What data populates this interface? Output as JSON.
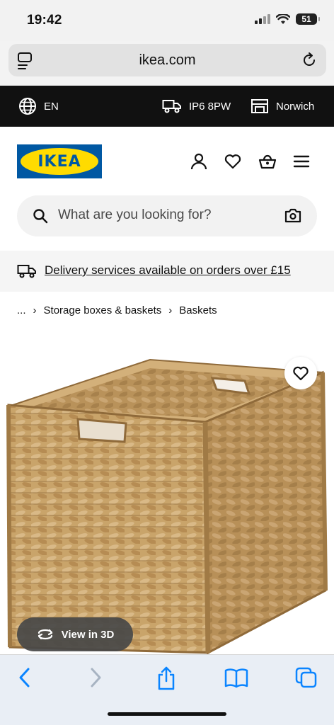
{
  "status": {
    "time": "19:42",
    "battery": "51"
  },
  "browser": {
    "url": "ikea.com"
  },
  "top_strip": {
    "language": "EN",
    "postcode": "IP6 8PW",
    "store": "Norwich"
  },
  "header": {
    "logo": "IKEA",
    "search_placeholder": "What are you looking for?"
  },
  "delivery": {
    "text": "Delivery services available on orders over £15"
  },
  "breadcrumb": {
    "ellipsis": "...",
    "items": [
      "Storage boxes & baskets",
      "Baskets"
    ]
  },
  "product": {
    "view_3d": "View in 3D"
  },
  "colors": {
    "brand_blue": "#0058a3",
    "brand_yellow": "#ffdb00",
    "strip_bg": "#111111",
    "ios_blue": "#0a84ff"
  }
}
